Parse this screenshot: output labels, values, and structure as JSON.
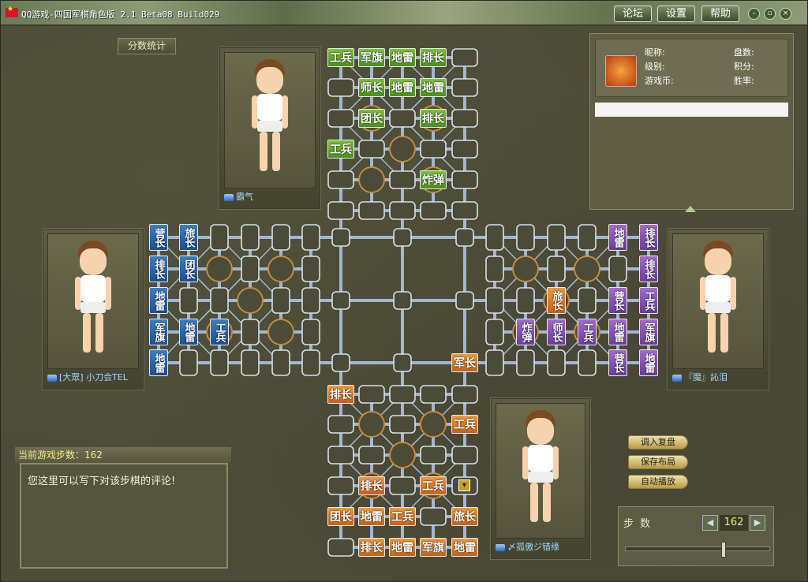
{
  "window": {
    "title": "QQ游戏-四国军棋角色版 2.1 Beta08 Build029",
    "buttons": {
      "forum": "论坛",
      "settings": "设置",
      "help": "帮助"
    }
  },
  "score_button": "分数统计",
  "info": {
    "nickname_label": "昵称:",
    "level_label": "级别:",
    "coins_label": "游戏币:",
    "games_label": "盘数:",
    "points_label": "积分:",
    "winrate_label": "胜率:"
  },
  "players": {
    "top": "霸气",
    "left": "[大眾] 小刀会TEL",
    "right": "『魔』訫泪",
    "bottom": "〆孤傲ジ错缘"
  },
  "pieces": {
    "green": [
      {
        "id": "g1",
        "label": "工兵"
      },
      {
        "id": "g2",
        "label": "军旗"
      },
      {
        "id": "g3",
        "label": "地雷"
      },
      {
        "id": "g4",
        "label": "排长"
      },
      {
        "id": "g5",
        "label": "师长"
      },
      {
        "id": "g6",
        "label": "地雷"
      },
      {
        "id": "g7",
        "label": "地雷"
      },
      {
        "id": "g8",
        "label": "团长"
      },
      {
        "id": "g9",
        "label": "排长"
      },
      {
        "id": "g10",
        "label": "工兵"
      },
      {
        "id": "g11",
        "label": "炸弹"
      }
    ],
    "blue": [
      {
        "id": "b1",
        "label": "营长"
      },
      {
        "id": "b2",
        "label": "旅长"
      },
      {
        "id": "b3",
        "label": "排长"
      },
      {
        "id": "b4",
        "label": "团长"
      },
      {
        "id": "b5",
        "label": "地雷"
      },
      {
        "id": "b6",
        "label": "军旗"
      },
      {
        "id": "b7",
        "label": "地雷"
      },
      {
        "id": "b8",
        "label": "工兵"
      },
      {
        "id": "b9",
        "label": "地雷"
      }
    ],
    "purple": [
      {
        "id": "p1",
        "label": "地雷"
      },
      {
        "id": "p2",
        "label": "排长"
      },
      {
        "id": "p3",
        "label": "排长"
      },
      {
        "id": "p4",
        "label": "营长"
      },
      {
        "id": "p5",
        "label": "工兵"
      },
      {
        "id": "p6",
        "label": "炸弹"
      },
      {
        "id": "p7",
        "label": "师长"
      },
      {
        "id": "p8",
        "label": "工兵"
      },
      {
        "id": "p9",
        "label": "地雷"
      },
      {
        "id": "p10",
        "label": "军旗"
      },
      {
        "id": "p11",
        "label": "营长"
      },
      {
        "id": "p12",
        "label": "地雷"
      }
    ],
    "orange": [
      {
        "id": "o1",
        "label": "旅长"
      },
      {
        "id": "o2",
        "label": "军长"
      },
      {
        "id": "o3",
        "label": "排长"
      },
      {
        "id": "o4",
        "label": "工兵"
      },
      {
        "id": "o5",
        "label": "排长"
      },
      {
        "id": "o6",
        "label": "工兵"
      },
      {
        "id": "o7",
        "label": "团长"
      },
      {
        "id": "o8",
        "label": "地雷"
      },
      {
        "id": "o9",
        "label": "工兵"
      },
      {
        "id": "o10",
        "label": "旅长"
      },
      {
        "id": "o11",
        "label": "排长"
      },
      {
        "id": "o12",
        "label": "地雷"
      },
      {
        "id": "o13",
        "label": "军旗"
      },
      {
        "id": "o14",
        "label": "地雷"
      }
    ]
  },
  "moves": {
    "label": "当前游戏步数：162",
    "comment_placeholder": "您这里可以写下对该步棋的评论!"
  },
  "side_buttons": {
    "load": "调入复盘",
    "save": "保存布局",
    "autoplay": "自动播放"
  },
  "step": {
    "label": "步数",
    "value": "162",
    "progress": 0.68
  },
  "colors": {
    "green": "#5ea82c",
    "blue": "#2a65aa",
    "purple": "#8650b8",
    "orange": "#e07b26",
    "track": "#9fb7d3"
  }
}
